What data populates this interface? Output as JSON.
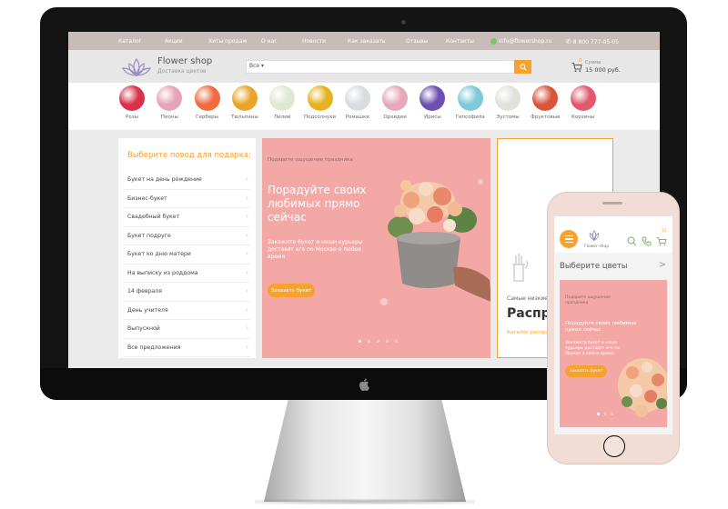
{
  "topnav": {
    "items": [
      "Каталог",
      "Акции",
      "Хиты продаж",
      "О нас",
      "Новости",
      "Как заказать",
      "Отзывы",
      "Контакты"
    ],
    "email": "info@flowershop.ru",
    "phone": "8 800 777-05-05"
  },
  "header": {
    "logo_title": "Flower shop",
    "logo_subtitle": "Доставка цветов",
    "search_select": "Все",
    "cart_count": "0",
    "cart_label": "Сумма",
    "cart_sum": "15 000 руб."
  },
  "categories": [
    {
      "label": "Розы",
      "color": "#d8324a"
    },
    {
      "label": "Пионы",
      "color": "#e7a3b7"
    },
    {
      "label": "Герберы",
      "color": "#ef6b3f"
    },
    {
      "label": "Тюльпаны",
      "color": "#e9a52b"
    },
    {
      "label": "Лилии",
      "color": "#dfe8d2"
    },
    {
      "label": "Подсолнухи",
      "color": "#e7b21f"
    },
    {
      "label": "Ромашки",
      "color": "#d7dde0"
    },
    {
      "label": "Орхидеи",
      "color": "#e6a9bb"
    },
    {
      "label": "Ирисы",
      "color": "#6c4fb1"
    },
    {
      "label": "Гипсофила",
      "color": "#7fc9d8"
    },
    {
      "label": "Эустомы",
      "color": "#dfe2d8"
    },
    {
      "label": "Фруктовые",
      "color": "#d8553c"
    },
    {
      "label": "Корзины",
      "color": "#e2586e"
    }
  ],
  "occasions": {
    "title": "Выберите повод для подарка:",
    "items": [
      "Букет на день рождение",
      "Бизнес-букет",
      "Свадебный букет",
      "Букет подруге",
      "Букет ко дню матери",
      "На выписку из роддома",
      "14 февраля",
      "День учителя",
      "Выпускной",
      "Все предложения"
    ]
  },
  "hero": {
    "small": "Подарите ощущение праздника",
    "title": "Порадуйте своих любимых прямо сейчас",
    "desc": "Закажите букет и наши курьеры доставят его по Москве в любое время",
    "button": "Заказать букет"
  },
  "promo": {
    "small": "Самые низкие ц",
    "big": "Распрод",
    "link": "Каталог распрод"
  },
  "phone": {
    "logo_text": "Flower shop",
    "cart_count": "12",
    "choose": "Выберите цветы",
    "hero_small": "Подарите ощущение праздника",
    "hero_title": "Порадуйте своих любимых прямо сейчас",
    "hero_desc": "Закажите букет и наши курьеры доставят его по Москве в любое время",
    "hero_button": "Заказать букет"
  },
  "colors": {
    "accent": "#f7a12e",
    "hero_bg": "#f4a8a6",
    "topnav_bg": "#c7bcb8"
  }
}
